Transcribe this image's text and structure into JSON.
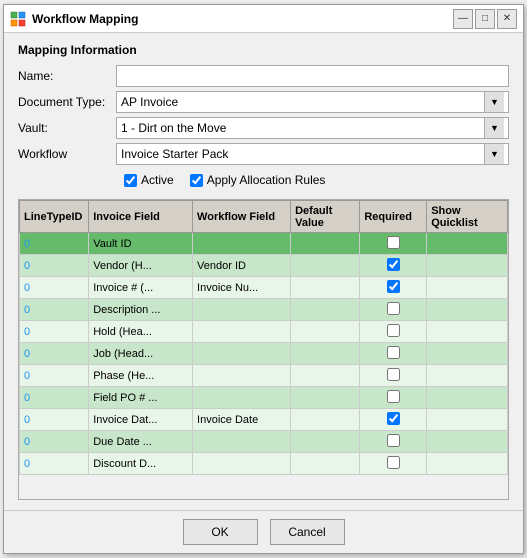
{
  "window": {
    "title": "Workflow Mapping",
    "icon": "workflow-icon"
  },
  "title_buttons": {
    "minimize": "—",
    "maximize": "□",
    "close": "✕"
  },
  "section": {
    "title": "Mapping Information"
  },
  "form": {
    "name_label": "Name:",
    "name_value": "",
    "document_type_label": "Document Type:",
    "document_type_value": "AP Invoice",
    "vault_label": "Vault:",
    "vault_value": "1 - Dirt on the Move",
    "workflow_label": "Workflow",
    "workflow_value": "Invoice Starter Pack",
    "active_label": "Active",
    "active_checked": true,
    "apply_rules_label": "Apply Allocation Rules",
    "apply_rules_checked": true
  },
  "table": {
    "columns": [
      {
        "id": "linetype",
        "label": "LineTypeID"
      },
      {
        "id": "invoice",
        "label": "Invoice Field"
      },
      {
        "id": "workflow",
        "label": "Workflow Field"
      },
      {
        "id": "default",
        "label": "Default Value"
      },
      {
        "id": "required",
        "label": "Required"
      },
      {
        "id": "show",
        "label": "Show Quicklist"
      }
    ],
    "rows": [
      {
        "linetype": "0",
        "invoice": "Vault ID",
        "workflow": "",
        "default": "",
        "required": false,
        "show": false,
        "selected": true
      },
      {
        "linetype": "0",
        "invoice": "Vendor  (H...",
        "workflow": "Vendor ID",
        "default": "",
        "required": true,
        "show": false,
        "selected": false
      },
      {
        "linetype": "0",
        "invoice": "Invoice #  (...",
        "workflow": "Invoice Nu...",
        "default": "",
        "required": true,
        "show": false,
        "selected": false
      },
      {
        "linetype": "0",
        "invoice": "Description ...",
        "workflow": "",
        "default": "",
        "required": false,
        "show": false,
        "selected": false
      },
      {
        "linetype": "0",
        "invoice": "Hold  (Hea...",
        "workflow": "",
        "default": "",
        "required": false,
        "show": false,
        "selected": false
      },
      {
        "linetype": "0",
        "invoice": "Job  (Head...",
        "workflow": "",
        "default": "",
        "required": false,
        "show": false,
        "selected": false
      },
      {
        "linetype": "0",
        "invoice": "Phase  (He...",
        "workflow": "",
        "default": "",
        "required": false,
        "show": false,
        "selected": false
      },
      {
        "linetype": "0",
        "invoice": "Field PO # ...",
        "workflow": "",
        "default": "",
        "required": false,
        "show": false,
        "selected": false
      },
      {
        "linetype": "0",
        "invoice": "Invoice Dat...",
        "workflow": "Invoice Date",
        "default": "",
        "required": true,
        "show": false,
        "selected": false
      },
      {
        "linetype": "0",
        "invoice": "Due Date  ...",
        "workflow": "",
        "default": "",
        "required": false,
        "show": false,
        "selected": false
      },
      {
        "linetype": "0",
        "invoice": "Discount D...",
        "workflow": "",
        "default": "",
        "required": false,
        "show": false,
        "selected": false
      }
    ]
  },
  "footer": {
    "ok_label": "OK",
    "cancel_label": "Cancel"
  }
}
